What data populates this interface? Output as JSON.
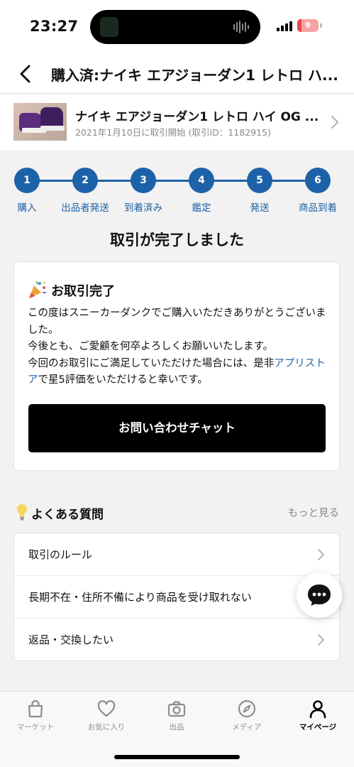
{
  "status_bar": {
    "time": "23:27",
    "battery": "9"
  },
  "header": {
    "title": "購入済:ナイキ エアジョーダン1 レトロ ハ..."
  },
  "product": {
    "name": "ナイキ エアジョーダン1 レトロ ハイ OG ...",
    "meta": "2021年1月10日に取引開始 (取引ID：1182915)"
  },
  "steps": [
    {
      "number": "1",
      "label": "購入"
    },
    {
      "number": "2",
      "label": "出品者発送"
    },
    {
      "number": "3",
      "label": "到着済み"
    },
    {
      "number": "4",
      "label": "鑑定"
    },
    {
      "number": "5",
      "label": "発送"
    },
    {
      "number": "6",
      "label": "商品到着"
    }
  ],
  "complete_title": "取引が完了しました",
  "card": {
    "heading": "お取引完了",
    "line1": "この度はスニーカーダンクでご購入いただきありがとうございました。",
    "line2": "今後とも、ご愛顧を何卒よろしくお願いいたします。",
    "line3_before": "今回のお取引にご満足していただけた場合には、是非",
    "line3_link": "アプリストア",
    "line3_after": "で星5評価をいただけると幸いです。",
    "chat_button": "お問い合わせチャット"
  },
  "faq": {
    "title": "よくある質問",
    "more": "もっと見る",
    "items": [
      "取引のルール",
      "長期不在・住所不備により商品を受け取れない",
      "返品・交換したい"
    ]
  },
  "tabs": [
    {
      "label": "マーケット",
      "icon": "bag-icon"
    },
    {
      "label": "お気に入り",
      "icon": "heart-icon"
    },
    {
      "label": "出品",
      "icon": "camera-icon"
    },
    {
      "label": "メディア",
      "icon": "compass-icon"
    },
    {
      "label": "マイページ",
      "icon": "person-icon"
    }
  ],
  "colors": {
    "accent": "#1d62a8",
    "button": "#000000",
    "background": "#f2f2f2"
  }
}
